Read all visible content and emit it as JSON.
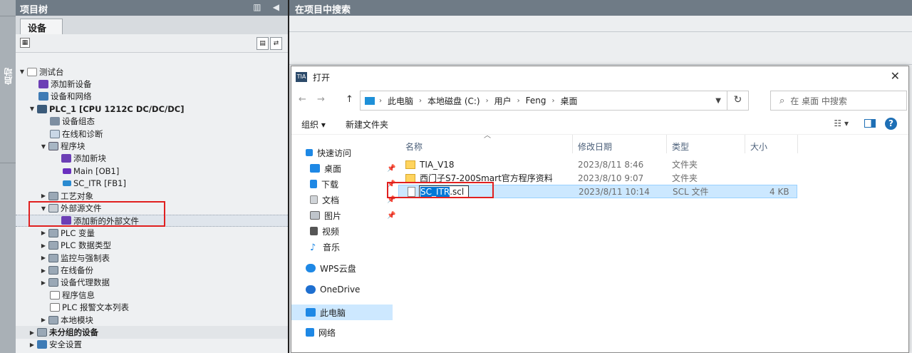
{
  "start_strip": {
    "label": "启动"
  },
  "project_tree": {
    "title": "项目树",
    "header_icons": "▥ ◀",
    "tab": "设备",
    "rows": [
      {
        "label": "测试台"
      },
      {
        "label": "添加新设备"
      },
      {
        "label": "设备和网络"
      },
      {
        "label": "PLC_1 [CPU 1212C DC/DC/DC]"
      },
      {
        "label": "设备组态"
      },
      {
        "label": "在线和诊断"
      },
      {
        "label": "程序块"
      },
      {
        "label": "添加新块"
      },
      {
        "label": "Main [OB1]"
      },
      {
        "label": "SC_ITR [FB1]"
      },
      {
        "label": "工艺对象"
      },
      {
        "label": "外部源文件"
      },
      {
        "label": "添加新的外部文件"
      },
      {
        "label": "PLC 变量"
      },
      {
        "label": "PLC 数据类型"
      },
      {
        "label": "监控与强制表"
      },
      {
        "label": "在线备份"
      },
      {
        "label": "设备代理数据"
      },
      {
        "label": "程序信息"
      },
      {
        "label": "PLC 报警文本列表"
      },
      {
        "label": "本地模块"
      },
      {
        "label": "未分组的设备"
      },
      {
        "label": "安全设置"
      }
    ]
  },
  "search_panel": {
    "title": "在项目中搜索"
  },
  "dialog": {
    "title": "打开",
    "close": "✕",
    "nav_back": "←",
    "nav_forward": "→",
    "nav_up": "↑",
    "breadcrumbs": [
      "此电脑",
      "本地磁盘 (C:)",
      "用户",
      "Feng",
      "桌面"
    ],
    "search_placeholder": "在 桌面 中搜索",
    "organize": "组织 ▾",
    "new_folder": "新建文件夹",
    "view_icon": "☷ ▾",
    "help": "?",
    "sidebar": [
      {
        "label": "快速访问",
        "icon": "star-icon",
        "color": "#1e88e5"
      },
      {
        "label": "桌面",
        "icon": "desktop-icon",
        "color": "#1e88e5"
      },
      {
        "label": "下载",
        "icon": "download-icon",
        "color": "#1e88e5"
      },
      {
        "label": "文档",
        "icon": "document-icon",
        "color": "#8a8a8a"
      },
      {
        "label": "图片",
        "icon": "picture-icon",
        "color": "#8a8a8a"
      },
      {
        "label": "视频",
        "icon": "video-icon",
        "color": "#555555"
      },
      {
        "label": "音乐",
        "icon": "music-icon",
        "color": "#1e88e5"
      },
      {
        "label": "WPS云盘",
        "icon": "cloud-icon",
        "color": "#1e88e5"
      },
      {
        "label": "OneDrive",
        "icon": "onedrive-icon",
        "color": "#1e6fd0"
      },
      {
        "label": "此电脑",
        "icon": "computer-icon",
        "color": "#1e88e5"
      },
      {
        "label": "网络",
        "icon": "network-icon",
        "color": "#1e88e5"
      }
    ],
    "columns": {
      "name": "名称",
      "date": "修改日期",
      "type": "类型",
      "size": "大小"
    },
    "files": [
      {
        "name": "TIA_V18",
        "date": "2023/8/11 8:46",
        "type": "文件夹",
        "size": ""
      },
      {
        "name": "西门子S7-200Smart官方程序资料",
        "date": "2023/8/10 9:07",
        "type": "文件夹",
        "size": ""
      },
      {
        "name_selected": "SC_ITR",
        "name_rest": ".scl",
        "date": "2023/8/11 10:14",
        "type": "SCL 文件",
        "size": "4 KB"
      }
    ]
  }
}
